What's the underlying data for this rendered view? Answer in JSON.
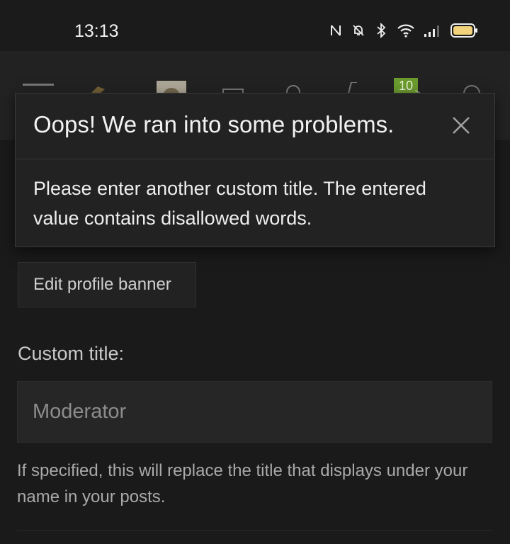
{
  "status_bar": {
    "time": "13:13",
    "icons": [
      "nfc-icon",
      "bell-muted-icon",
      "bluetooth-icon",
      "wifi-icon",
      "signal-icon",
      "battery-icon"
    ],
    "battery_color": "#f2d27a"
  },
  "nav": {
    "icons": [
      "menu-icon",
      "rocket-icon",
      "avatar",
      "inbox-icon",
      "alerts-icon",
      "bolt-icon",
      "media-icon",
      "search-icon"
    ],
    "badge": "10",
    "badge_color": "#6b9a2e"
  },
  "error_dialog": {
    "title": "Oops! We ran into some problems.",
    "message": "Please enter another custom title. The entered value contains disallowed words."
  },
  "form": {
    "edit_banner_label": "Edit profile banner",
    "custom_title_label": "Custom title:",
    "custom_title_value": "",
    "custom_title_placeholder": "Moderator",
    "custom_title_hint": "If specified, this will replace the title that displays under your name in your posts."
  }
}
